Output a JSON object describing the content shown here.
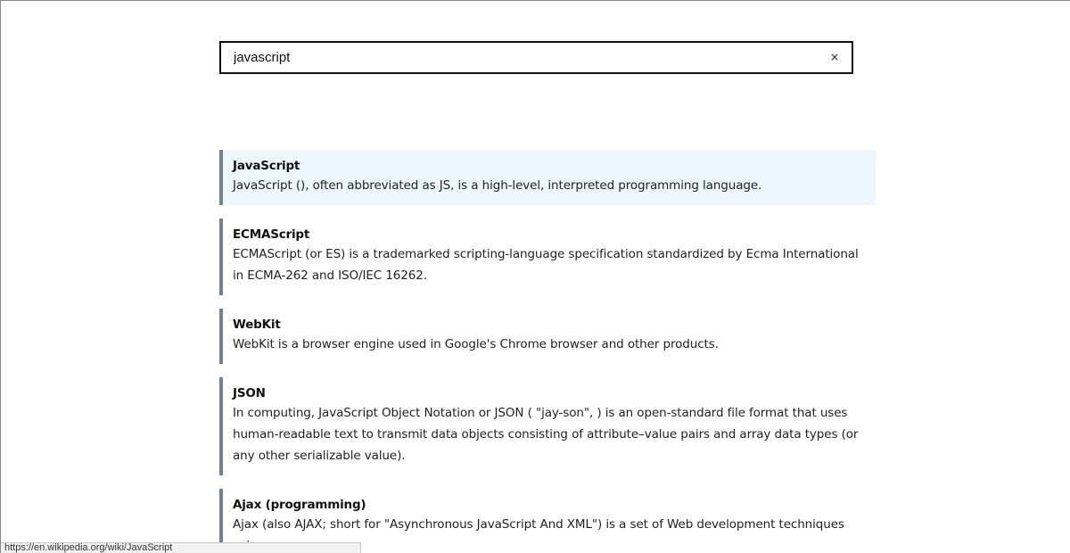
{
  "search": {
    "value": "javascript",
    "clear_label": "×"
  },
  "results": [
    {
      "title": "JavaScript",
      "extract": "JavaScript (), often abbreviated as JS, is a high-level, interpreted programming language."
    },
    {
      "title": "ECMAScript",
      "extract": "ECMAScript (or ES) is a trademarked scripting-language specification standardized by Ecma International in ECMA-262 and ISO/IEC 16262."
    },
    {
      "title": "WebKit",
      "extract": "WebKit is a browser engine used in Google's Chrome browser and other products."
    },
    {
      "title": "JSON",
      "extract": "In computing, JavaScript Object Notation or JSON ( \"jay-son\", ) is an open-standard file format that uses human-readable text to transmit data objects consisting of attribute–value pairs and array data types (or any other serializable value)."
    },
    {
      "title": "Ajax (programming)",
      "extract": "Ajax (also AJAX; short for \"Asynchronous JavaScript And XML\") is a set of Web development techniques using"
    }
  ],
  "status_bar": {
    "url": "https://en.wikipedia.org/wiki/JavaScript"
  }
}
